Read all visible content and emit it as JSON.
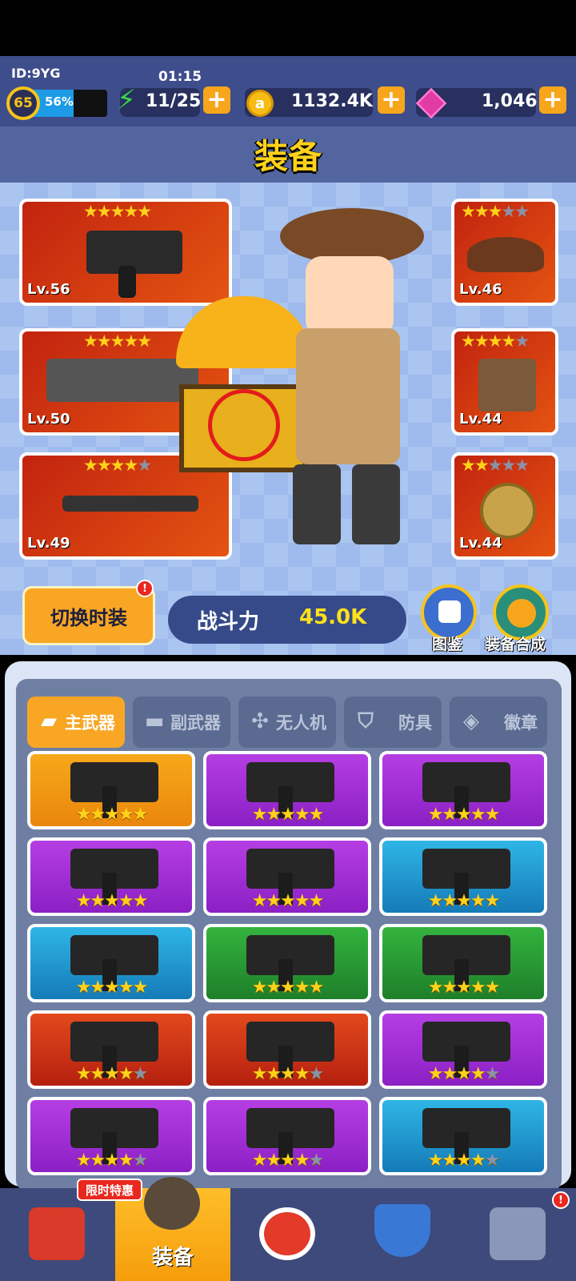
{
  "player": {
    "id": "ID:9YG",
    "level": "65",
    "xp_percent": "56%",
    "xp_fraction": 0.56
  },
  "timer": "01:15",
  "resources": {
    "energy": "11/25",
    "coins": "1132.4K",
    "gems": "1,046",
    "plus": "+"
  },
  "title": "装备",
  "equipped": {
    "left": [
      {
        "name": "smg",
        "level": "Lv.56",
        "stars": 5
      },
      {
        "name": "rocket-launcher",
        "level": "Lv.50",
        "stars": 5
      },
      {
        "name": "drone",
        "level": "Lv.49",
        "stars": 4
      }
    ],
    "right": [
      {
        "name": "hat",
        "level": "Lv.46",
        "stars": 3
      },
      {
        "name": "armor",
        "level": "Lv.44",
        "stars": 4
      },
      {
        "name": "badge",
        "level": "Lv.44",
        "stars": 2
      }
    ]
  },
  "actions": {
    "fashion": "切换时装",
    "fashion_badge": "!",
    "power_label": "战斗力",
    "power_value": "45.0K",
    "codex": "图鉴",
    "synth": "装备合成"
  },
  "tabs": [
    {
      "label": "主武器",
      "icon": "pistol-icon",
      "active": true
    },
    {
      "label": "副武器",
      "icon": "rifle-icon",
      "active": false
    },
    {
      "label": "无人机",
      "icon": "drone-icon",
      "active": false
    },
    {
      "label": "防具",
      "icon": "shield-icon",
      "active": false
    },
    {
      "label": "徽章",
      "icon": "medal-icon",
      "active": false
    }
  ],
  "inventory": [
    {
      "color": "orange",
      "stars": 5
    },
    {
      "color": "purple",
      "stars": 5
    },
    {
      "color": "purple",
      "stars": 5
    },
    {
      "color": "purple",
      "stars": 5
    },
    {
      "color": "purple",
      "stars": 5
    },
    {
      "color": "blue",
      "stars": 5
    },
    {
      "color": "blue",
      "stars": 5
    },
    {
      "color": "green",
      "stars": 5
    },
    {
      "color": "green",
      "stars": 5
    },
    {
      "color": "red",
      "stars": 4
    },
    {
      "color": "red",
      "stars": 4
    },
    {
      "color": "purple",
      "stars": 4
    },
    {
      "color": "purple",
      "stars": 4
    },
    {
      "color": "purple",
      "stars": 4
    },
    {
      "color": "blue",
      "stars": 4
    }
  ],
  "nav": {
    "promo": "限时特惠",
    "equip_label": "装备",
    "items": [
      "shop-icon",
      "equipment-icon",
      "target-icon",
      "rank-shield-icon",
      "pistols-icon"
    ],
    "badge": "!"
  }
}
